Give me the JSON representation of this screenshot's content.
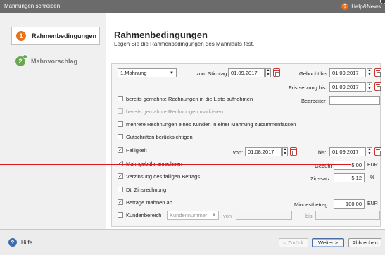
{
  "window": {
    "title": "Mahnungen schreiben",
    "help_label": "Help&News"
  },
  "steps": [
    {
      "number": "1",
      "label": "Rahmenbedingungen"
    },
    {
      "number": "2",
      "label": "Mahnvorschlag"
    }
  ],
  "main": {
    "heading": "Rahmenbedingungen",
    "subheading": "Legen Sie die Rahmenbedingungen des Mahnlaufs fest."
  },
  "form": {
    "mahnstufe": "1.Mahnung",
    "stichtag_label": "zum Stichtag",
    "stichtag": "01.09.2017",
    "gebucht_label": "Gebucht bis:",
    "gebucht": "01.09.2017",
    "fristsetzung_label": "Fristsetzung bis:",
    "fristsetzung": "01.09.2017",
    "bearbeiter_label": "Bearbeiter",
    "bearbeiter": "",
    "opt_bereits_aufnehmen": "bereits gemahnte Rechnungen in die Liste aufnehmen",
    "opt_bereits_markieren": "bereits gemahnte Rechnungen markieren",
    "opt_mehrere": "mehrere Rechnungen eines Kunden in einer Mahnung zusammenfassen",
    "opt_gutschriften": "Gutschriften berücksichtigen",
    "opt_faelligkeit": "Fälligkeit",
    "von_label": "von:",
    "faellig_von": "01.08.2017",
    "bis_label": "bis:",
    "faellig_bis": "01.09.2017",
    "opt_mahngebuehr": "Mahngebühr anrechnen",
    "gebuehr_label": "Gebühr",
    "gebuehr": "5,00",
    "gebuehr_unit": "EUR",
    "opt_verzinsung": "Verzinsung des fälligen Betrags",
    "zinssatz_label": "Zinssatz",
    "zinssatz": "5,12",
    "zinssatz_unit": "%",
    "opt_dt_zinsrechnung": "Dt. Zinsrechnung",
    "opt_betraege": "Beträge mahnen ab",
    "mindestbetrag_label": "Mindestbetrag",
    "mindestbetrag": "100,00",
    "mindestbetrag_unit": "EUR",
    "opt_kundenbereich": "Kundenbereich",
    "kunden_combo": "Kundennummer",
    "kunden_von_label": "von",
    "kunden_von": "",
    "kunden_bis_label": "bis",
    "kunden_bis": ""
  },
  "footer": {
    "help": "Hilfe",
    "back": "< Zurück",
    "next": "Weiter >",
    "cancel": "Abbrechen"
  },
  "colors": {
    "accent_orange": "#e8731f",
    "accent_green": "#6aa84f",
    "callout_red": "#d9191e"
  }
}
